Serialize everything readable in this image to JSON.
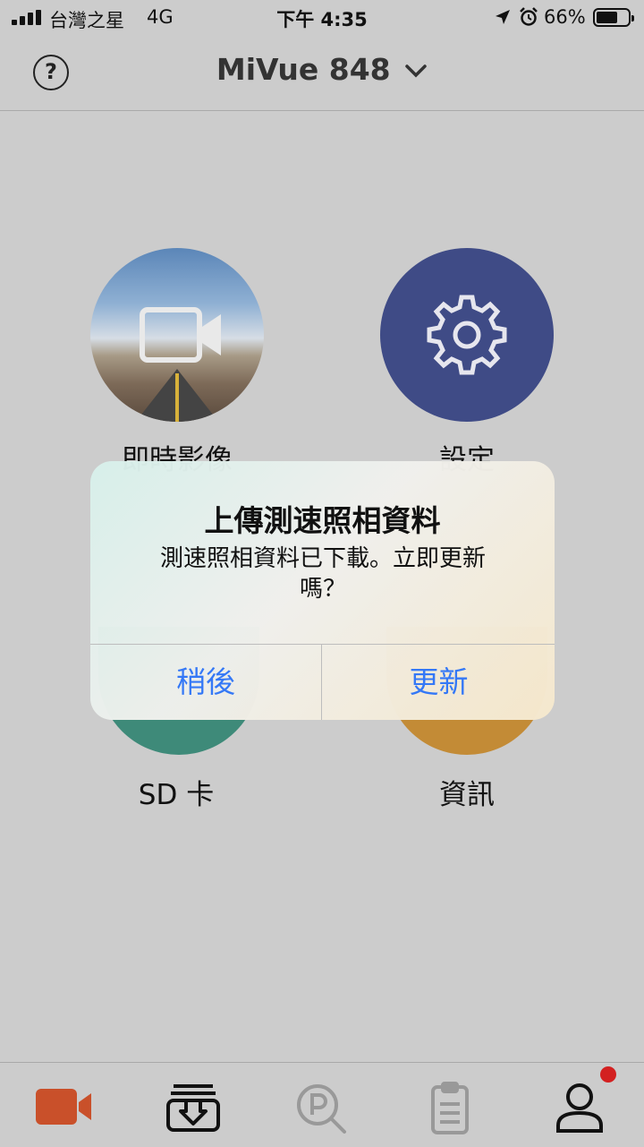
{
  "status_bar": {
    "carrier": "台灣之星",
    "network": "4G",
    "time": "下午 4:35",
    "battery_percent": "66%",
    "battery_level": 0.66,
    "icons": [
      "signal-icon",
      "location-icon",
      "alarm-icon",
      "battery-icon"
    ]
  },
  "header": {
    "title": "MiVue 848",
    "help_icon": "question-icon",
    "dropdown_icon": "chevron-down-icon"
  },
  "tiles": [
    {
      "label": "即時影像",
      "icon": "video-camera-icon",
      "color": "#5b86b8"
    },
    {
      "label": "設定",
      "icon": "gear-icon",
      "color": "#3f4b86"
    },
    {
      "label": "SD 卡",
      "icon": "sd-card-icon",
      "color": "#3e8a79"
    },
    {
      "label": "資訊",
      "icon": "info-icon",
      "color": "#c38b36"
    }
  ],
  "dialog": {
    "title": "上傳測速照相資料",
    "message": "測速照相資料已下載。立即更新嗎？",
    "buttons": {
      "cancel": "稍後",
      "confirm": "更新"
    },
    "button_color": "#3478f6"
  },
  "tab_bar": {
    "items": [
      {
        "icon": "video-camera-icon",
        "active": true,
        "color": "#c9502a"
      },
      {
        "icon": "download-tray-icon",
        "active": false
      },
      {
        "icon": "parking-search-icon",
        "active": false
      },
      {
        "icon": "clipboard-icon",
        "active": false
      },
      {
        "icon": "user-icon",
        "active": false,
        "badge": true,
        "badge_color": "#d32020"
      }
    ]
  }
}
